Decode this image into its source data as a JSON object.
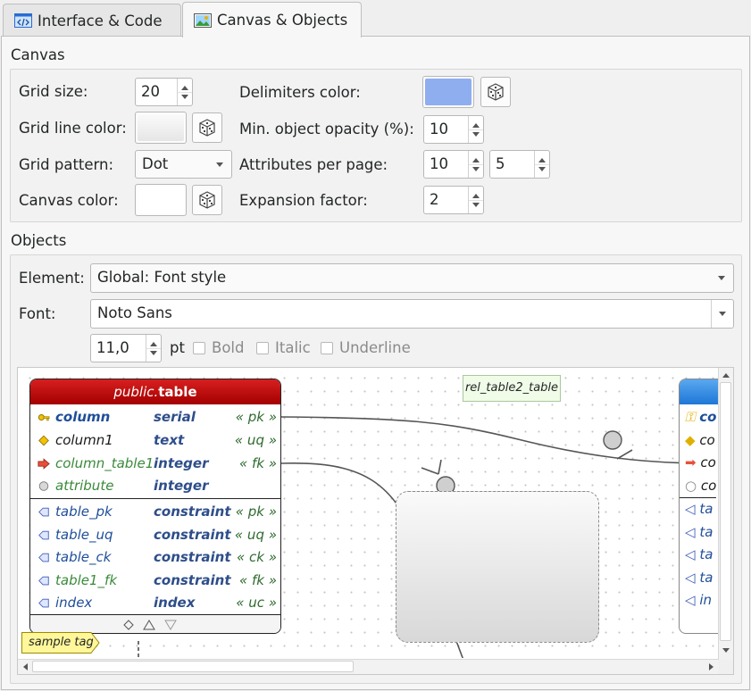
{
  "tabs": [
    {
      "label": "Interface & Code",
      "active": false,
      "icon": "code-window-icon"
    },
    {
      "label": "Canvas & Objects",
      "active": true,
      "icon": "canvas-image-icon"
    }
  ],
  "canvas_section": {
    "title": "Canvas",
    "grid_size": {
      "label": "Grid size:",
      "value": "20"
    },
    "grid_line_color": {
      "label": "Grid line color:",
      "color": "#e8e8e8"
    },
    "grid_pattern": {
      "label": "Grid pattern:",
      "value": "Dot"
    },
    "canvas_color": {
      "label": "Canvas color:",
      "color": "#ffffff"
    },
    "delimiters_color": {
      "label": "Delimiters color:",
      "color": "#8eaef0"
    },
    "min_opacity": {
      "label": "Min. object opacity (%):",
      "value": "10"
    },
    "attributes_per_page": {
      "label": "Attributes per page:",
      "value1": "10",
      "value2": "5"
    },
    "expansion_factor": {
      "label": "Expansion factor:",
      "value": "2"
    }
  },
  "objects_section": {
    "title": "Objects",
    "element": {
      "label": "Element:",
      "value": "Global: Font style"
    },
    "font": {
      "label": "Font:",
      "value": "Noto Sans"
    },
    "size": {
      "value": "11,0",
      "unit": "pt"
    },
    "bold": {
      "label": "Bold",
      "checked": false
    },
    "italic": {
      "label": "Italic",
      "checked": false
    },
    "underline": {
      "label": "Underline",
      "checked": false
    }
  },
  "preview": {
    "table": {
      "schema": "public.",
      "name": "table",
      "columns": [
        {
          "name": "column",
          "type": "serial",
          "constraint": "« pk »",
          "icon": "key-icon"
        },
        {
          "name": "column1",
          "type": "text",
          "constraint": "« uq »",
          "icon": "diamond-icon"
        },
        {
          "name": "column_table1",
          "type": "integer",
          "constraint": "« fk »",
          "icon": "arrow-right-icon"
        },
        {
          "name": "attribute",
          "type": "integer",
          "constraint": "",
          "icon": "circle-icon"
        }
      ],
      "extras": [
        {
          "name": "table_pk",
          "type": "constraint",
          "constraint": "« pk »"
        },
        {
          "name": "table_uq",
          "type": "constraint",
          "constraint": "« uq »"
        },
        {
          "name": "table_ck",
          "type": "constraint",
          "constraint": "« ck »"
        },
        {
          "name": "table1_fk",
          "type": "constraint",
          "constraint": "« fk »"
        },
        {
          "name": "index",
          "type": "index",
          "constraint": "« uc »"
        }
      ]
    },
    "relationship_label": "rel_table2_table",
    "tag": "sample tag",
    "table2_rows": [
      "co",
      "co",
      "co",
      "co",
      "ta",
      "ta",
      "ta",
      "ta",
      "in"
    ],
    "colors": {
      "table_header": "#c00000",
      "table2_header": "#2b85e0",
      "fk_text": "#3a8a3a",
      "pk_text": "#1f4e99",
      "tag_fill": "#fff799"
    }
  }
}
